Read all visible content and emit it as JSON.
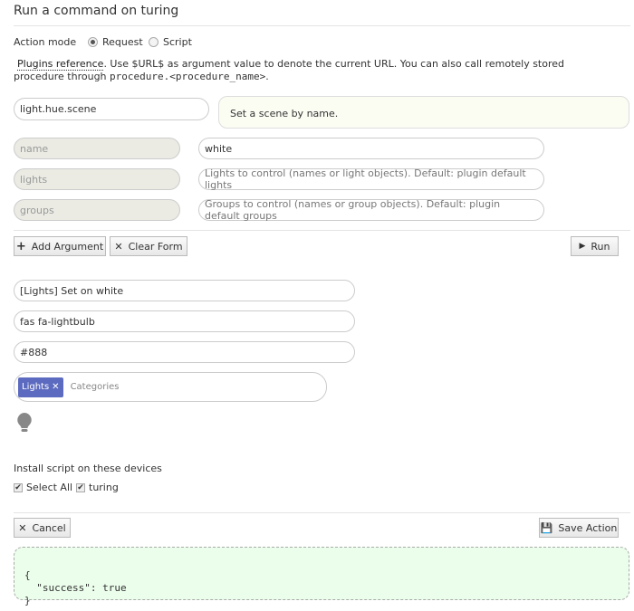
{
  "title": "Run a command on turing",
  "action_mode": {
    "label": "Action mode",
    "options": [
      "Request",
      "Script"
    ],
    "selected": "Request"
  },
  "help": {
    "link": "Plugins reference",
    "text1": ". Use $URL$ as argument value to denote the current URL. You can also call remotely stored",
    "text2": "procedure through ",
    "code": "procedure.<procedure_name>",
    "text3": "."
  },
  "action": {
    "value": "light.hue.scene",
    "doc": "Set a scene by name."
  },
  "arguments": [
    {
      "name": "name",
      "value": "white",
      "placeholder": ""
    },
    {
      "name": "lights",
      "value": "",
      "placeholder": "Lights to control (names or light objects). Default: plugin default lights"
    },
    {
      "name": "groups",
      "value": "",
      "placeholder": "Groups to control (names or group objects). Default: plugin default groups"
    }
  ],
  "buttons": {
    "add_argument": "Add Argument",
    "clear_form": "Clear Form",
    "run": "Run",
    "cancel": "Cancel",
    "save": "Save Action"
  },
  "save_form": {
    "name": "[Lights] Set on white",
    "icon": "fas fa-lightbulb",
    "color": "#888",
    "tag": "Lights",
    "tag_color": "#5c6bc0",
    "categories_placeholder": "Categories",
    "icon_preview": "lightbulb-icon"
  },
  "devices": {
    "label": "Install script on these devices",
    "select_all": "Select All",
    "items": [
      "turing"
    ]
  },
  "response": {
    "line1": "{",
    "line2": "  \"success\": true",
    "line3": "}"
  }
}
